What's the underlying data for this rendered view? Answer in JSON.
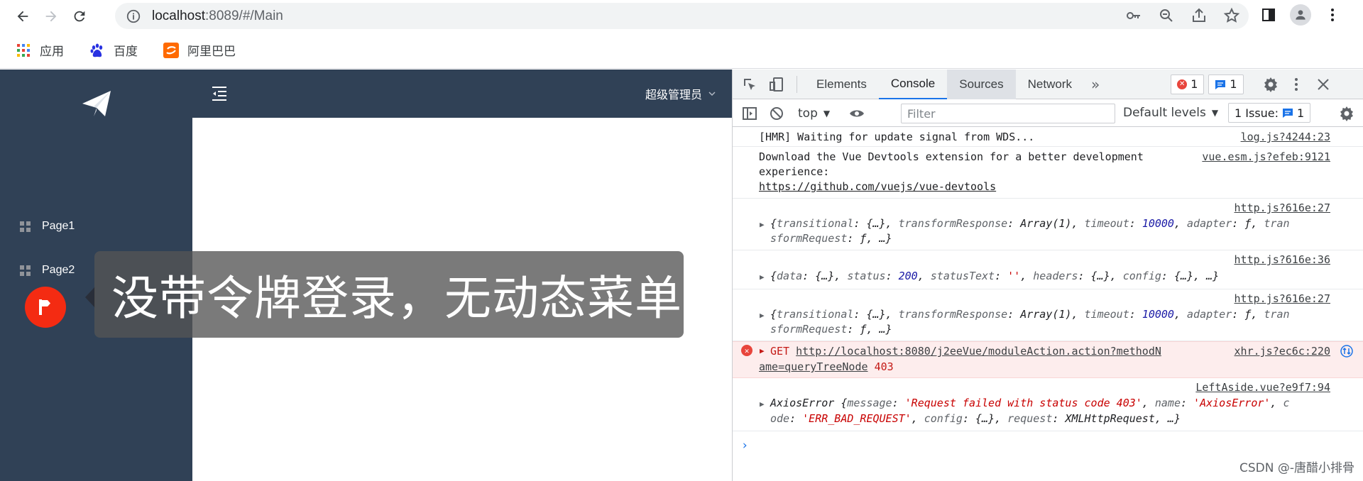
{
  "browser": {
    "url_host": "localhost",
    "url_rest": ":8089/#/Main",
    "bookmarks": [
      {
        "label": "应用",
        "icon": "apps-grid-icon"
      },
      {
        "label": "百度",
        "icon": "baidu-paw-icon"
      },
      {
        "label": "阿里巴巴",
        "icon": "alibaba-icon"
      }
    ]
  },
  "app": {
    "menu": [
      {
        "label": "Page1"
      },
      {
        "label": "Page2"
      }
    ],
    "user_menu_label": "超级管理员",
    "overlay_caption": "没带令牌登录，无动态菜单"
  },
  "devtools": {
    "tabs": [
      "Elements",
      "Console",
      "Sources",
      "Network"
    ],
    "active_tab": "Console",
    "selected_tab": "Sources",
    "error_count": "1",
    "message_count": "1",
    "context": "top",
    "filter_placeholder": "Filter",
    "levels": "Default levels",
    "issues_label": "1 Issue:",
    "issues_count": "1",
    "messages": [
      {
        "text": "[HMR] Waiting for update signal from WDS...",
        "source": "log.js?4244:23"
      },
      {
        "text_1": "Download the Vue Devtools extension for a better development",
        "text_2": "experience:",
        "link": "https://github.com/vuejs/vue-devtools",
        "source": "vue.esm.js?efeb:9121"
      },
      {
        "source": "http.js?616e:27"
      },
      {
        "source": "http.js?616e:36"
      },
      {
        "source": "http.js?616e:27"
      },
      {
        "method": "GET",
        "url_1": "http://localhost:8080/j2eeVue/moduleAction.action?methodN",
        "url_2": "ame=queryTreeNode",
        "status": "403",
        "source": "xhr.js?ec6c:220"
      },
      {
        "source": "LeftAside.vue?e9f7:94"
      }
    ]
  },
  "watermark": "CSDN @-唐醋小排骨"
}
